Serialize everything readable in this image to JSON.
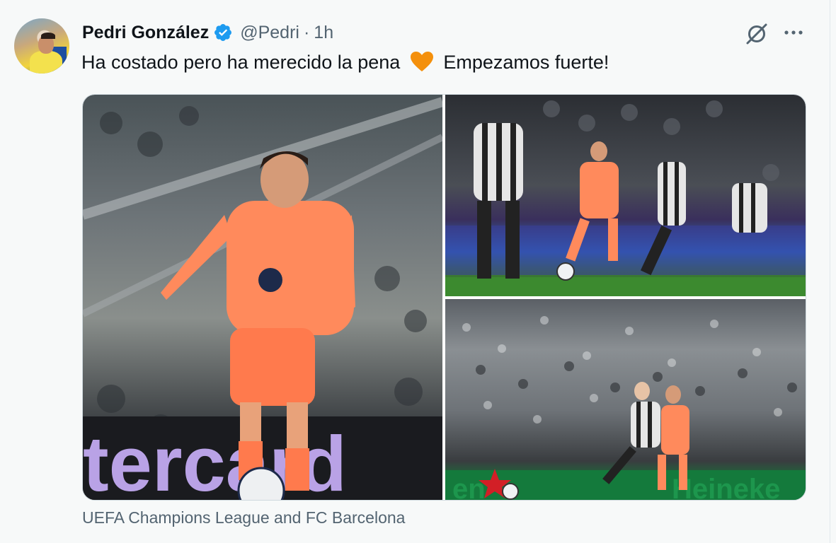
{
  "author": {
    "name": "Pedri González",
    "handle": "@Pedri",
    "separator": "·",
    "time": "1h"
  },
  "tweet": {
    "text_before": "Ha costado pero ha merecido la pena",
    "emoji": "orange-heart",
    "text_after": "Empezamos fuerte!"
  },
  "media": {
    "tagged_caption": "UEFA Champions League and FC Barcelona",
    "photos": [
      {
        "description_icon": "player-photo"
      },
      {
        "description_icon": "match-photo"
      },
      {
        "description_icon": "stadium-photo"
      }
    ],
    "banner_text_1": "tercard",
    "banner_text_2": "en",
    "banner_text_3": "Heineke"
  },
  "colors": {
    "verified": "#1d9bf0",
    "heart": "#f4900c",
    "kit": "#ff8a5c",
    "text_secondary": "#536471"
  }
}
